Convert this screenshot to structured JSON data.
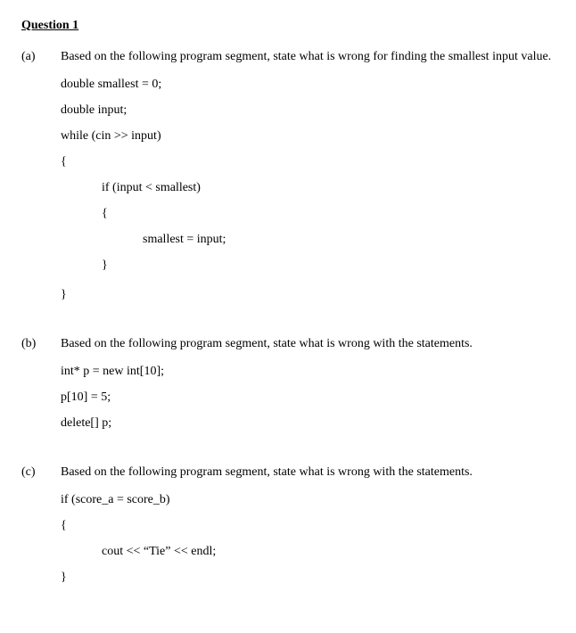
{
  "title": "Question 1",
  "parts": {
    "a": {
      "label": "(a)",
      "prompt": "Based on the following program segment, state what is wrong for finding the smallest input value.",
      "code": {
        "l1": "double smallest = 0;",
        "l2": "double input;",
        "l3": "while (cin >> input)",
        "l4": "{",
        "l5": "if (input < smallest)",
        "l6": "{",
        "l7": "smallest = input;",
        "l8": "}",
        "l9": "}"
      }
    },
    "b": {
      "label": "(b)",
      "prompt": "Based on the following program segment, state what is wrong with the statements.",
      "code": {
        "l1": "int* p = new int[10];",
        "l2": "p[10] = 5;",
        "l3": "delete[] p;"
      }
    },
    "c": {
      "label": "(c)",
      "prompt": "Based on the following program segment, state what is wrong with the statements.",
      "code": {
        "l1": "if (score_a = score_b)",
        "l2": "{",
        "l3": "cout << “Tie” << endl;",
        "l4": "}"
      }
    }
  }
}
